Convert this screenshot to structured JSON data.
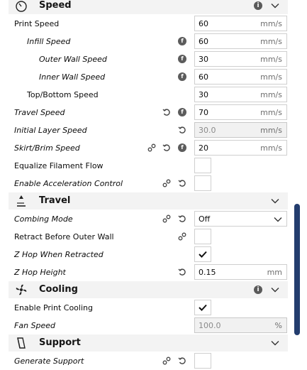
{
  "categories": {
    "speed": {
      "title": "Speed",
      "icon": "speed-icon"
    },
    "travel": {
      "title": "Travel",
      "icon": "travel-icon"
    },
    "cooling": {
      "title": "Cooling",
      "icon": "cooling-icon"
    },
    "support": {
      "title": "Support",
      "icon": "support-icon"
    }
  },
  "settings": {
    "print_speed": {
      "label": "Print Speed",
      "value": "60",
      "unit": "mm/s"
    },
    "infill_speed": {
      "label": "Infill Speed",
      "value": "60",
      "unit": "mm/s"
    },
    "outer_wall_speed": {
      "label": "Outer Wall Speed",
      "value": "30",
      "unit": "mm/s"
    },
    "inner_wall_speed": {
      "label": "Inner Wall Speed",
      "value": "60",
      "unit": "mm/s"
    },
    "top_bottom_speed": {
      "label": "Top/Bottom Speed",
      "value": "30",
      "unit": "mm/s"
    },
    "travel_speed": {
      "label": "Travel Speed",
      "value": "70",
      "unit": "mm/s"
    },
    "initial_layer_speed": {
      "label": "Initial Layer Speed",
      "value": "30.0",
      "unit": "mm/s"
    },
    "skirt_brim_speed": {
      "label": "Skirt/Brim Speed",
      "value": "20",
      "unit": "mm/s"
    },
    "equalize_filament_flow": {
      "label": "Equalize Filament Flow",
      "checked": false
    },
    "enable_acceleration_control": {
      "label": "Enable Acceleration Control",
      "checked": false
    },
    "combing_mode": {
      "label": "Combing Mode",
      "value": "Off"
    },
    "retract_before_outer_wall": {
      "label": "Retract Before Outer Wall",
      "checked": false
    },
    "z_hop_when_retracted": {
      "label": "Z Hop When Retracted",
      "checked": true
    },
    "z_hop_height": {
      "label": "Z Hop Height",
      "value": "0.15",
      "unit": "mm"
    },
    "enable_print_cooling": {
      "label": "Enable Print Cooling",
      "checked": true
    },
    "fan_speed": {
      "label": "Fan Speed",
      "value": "100.0",
      "unit": "%"
    },
    "generate_support": {
      "label": "Generate Support",
      "checked": false
    }
  },
  "glyphs": {
    "info": "i",
    "function": "f"
  },
  "colors": {
    "scrollbar": "#233d6e",
    "category_bg": "#f3f3f3",
    "field_border": "#cfcfcf"
  }
}
